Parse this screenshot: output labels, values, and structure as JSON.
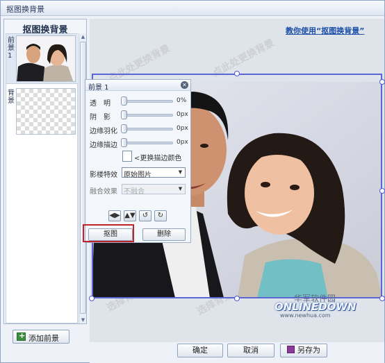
{
  "window": {
    "title": "抠图换背景"
  },
  "left_panel": {
    "title": "抠图换背景",
    "layers": [
      {
        "label": "前景 1",
        "thumbnail": "photo"
      },
      {
        "label": "背景",
        "thumbnail": "checkerboard"
      }
    ],
    "add_button": "添加前景"
  },
  "help_link": "教你使用“抠图换背景”",
  "props": {
    "title": "前景 1",
    "sliders": [
      {
        "label": "透　明",
        "value": "0%"
      },
      {
        "label": "阴　影",
        "value": "0px"
      },
      {
        "label": "边缘羽化",
        "value": "0px"
      },
      {
        "label": "边缘描边",
        "value": "0px"
      }
    ],
    "stroke_color_label": "<更换描边颜色",
    "effect_label": "影楼特效",
    "effect_value": "原始图片",
    "blend_label": "融合效果",
    "blend_value": "不融合",
    "cutout_button": "抠图",
    "delete_button": "删除"
  },
  "watermarks": [
    "点此处更换背景",
    "选择背景"
  ],
  "buttons": {
    "ok": "确定",
    "cancel": "取消",
    "save_as": "另存为"
  },
  "logo": {
    "cn": "华军软件园",
    "en": "ONLINEDOWN",
    "url": "www.newhua.com"
  },
  "colors": {
    "selection": "#5a66d6",
    "highlight": "#c0242a",
    "link": "#1b4fa8"
  }
}
